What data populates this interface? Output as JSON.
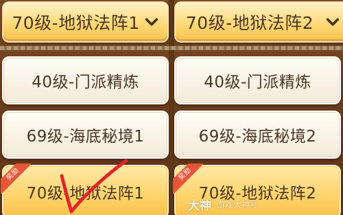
{
  "dropdowns": [
    {
      "label": "70级-地狱法阵1",
      "icon": "chevron-down-icon"
    },
    {
      "label": "70级-地狱法阵2",
      "icon": "chevron-down-icon"
    }
  ],
  "options_left": [
    {
      "label": "40级-门派精炼"
    },
    {
      "label": "69级-海底秘境1"
    },
    {
      "label": "70级-地狱法阵1",
      "badge": "奖励",
      "selected": true
    }
  ],
  "options_right": [
    {
      "label": "40级-门派精炼"
    },
    {
      "label": "69级-海底秘境2"
    },
    {
      "label": "70级-地狱法阵2",
      "badge": "奖励",
      "selected": true
    }
  ],
  "annotation": {
    "icon": "checkmark-icon",
    "color": "#e0262a"
  },
  "watermark": {
    "logo": "大神",
    "text": "游戏大神号"
  },
  "colors": {
    "dropdown_bg": "#ffd978",
    "option_bg": "#f6efe2",
    "selected_bg": "#ffd36a",
    "badge": "#e7553a",
    "text": "#4a3524",
    "background": "#6a3f1c"
  }
}
